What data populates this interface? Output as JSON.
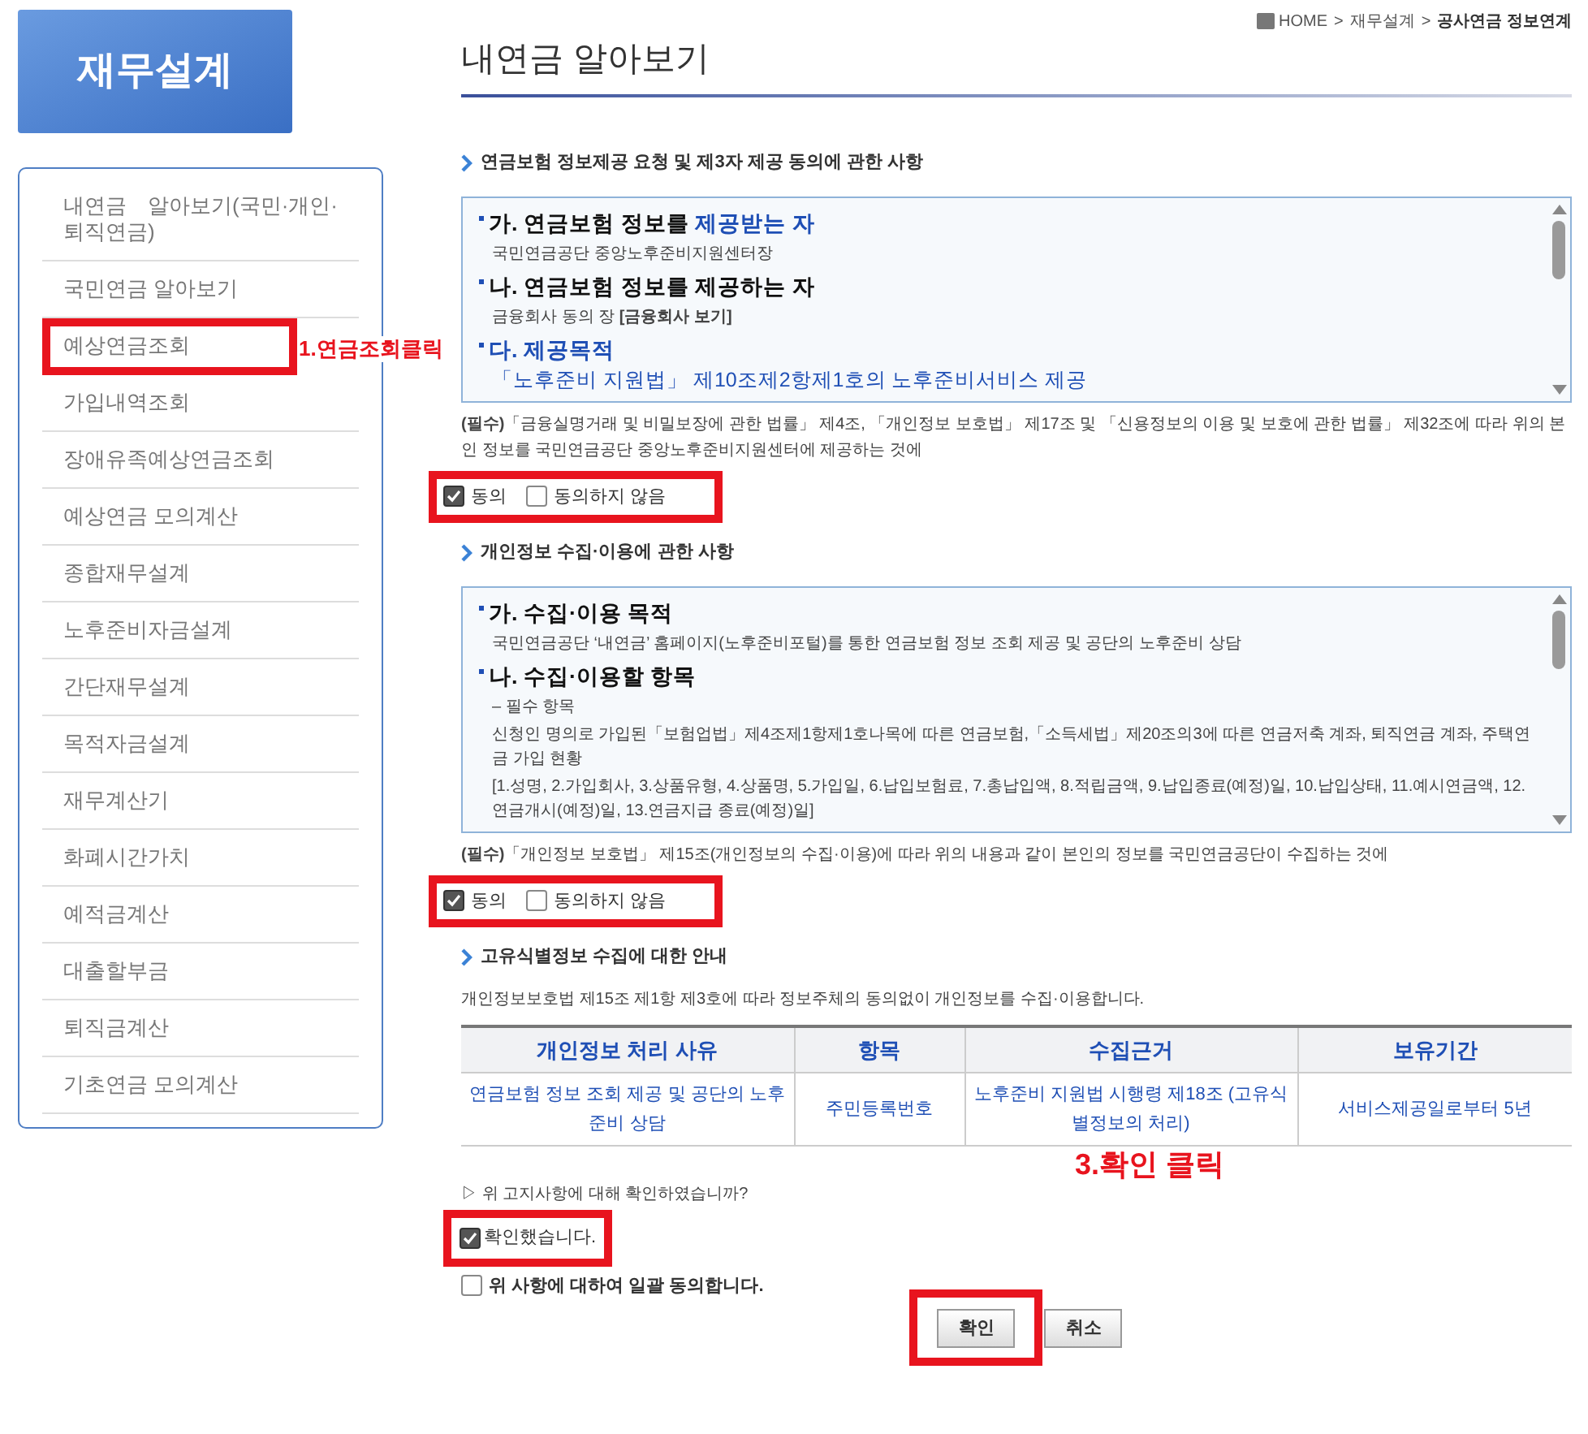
{
  "logo": "재무설계",
  "breadcrumb": [
    {
      "kind": "home",
      "label": "HOME"
    },
    {
      "kind": "sep",
      "label": ">"
    },
    {
      "kind": "link",
      "label": "재무설계"
    },
    {
      "kind": "sep",
      "label": ">"
    },
    {
      "kind": "current",
      "label": "공사연금 정보연계"
    }
  ],
  "sidebar": [
    {
      "label": "내연금　알아보기(국민·개인·퇴직연금)",
      "highlighted": false
    },
    {
      "label": "국민연금 알아보기",
      "highlighted": false
    },
    {
      "label": "예상연금조회",
      "highlighted": true
    },
    {
      "label": "가입내역조회",
      "highlighted": false
    },
    {
      "label": "장애유족예상연금조회",
      "highlighted": false
    },
    {
      "label": "예상연금 모의계산",
      "highlighted": false
    },
    {
      "label": "종합재무설계",
      "highlighted": false
    },
    {
      "label": "노후준비자금설계",
      "highlighted": false
    },
    {
      "label": "간단재무설계",
      "highlighted": false
    },
    {
      "label": "목적자금설계",
      "highlighted": false
    },
    {
      "label": "재무계산기",
      "highlighted": false
    },
    {
      "label": "화폐시간가치",
      "highlighted": false
    },
    {
      "label": "예적금계산",
      "highlighted": false
    },
    {
      "label": "대출할부금",
      "highlighted": false
    },
    {
      "label": "퇴직금계산",
      "highlighted": false
    },
    {
      "label": "기초연금 모의계산",
      "highlighted": false
    }
  ],
  "page_title": "내연금 알아보기",
  "sections": [
    {
      "heading": "연금보험 정보제공 요청 및 제3자 제공 동의에 관한 사항",
      "box": [
        {
          "kind": "heading",
          "parts": [
            {
              "text": "가. 연금보험 정보를 ",
              "blue": false
            },
            {
              "text": "제공받는 자",
              "blue": true
            }
          ]
        },
        {
          "kind": "text",
          "parts": [
            {
              "text": "국민연금공단 중앙노후준비지원센터장",
              "blue": false
            }
          ]
        },
        {
          "kind": "heading",
          "parts": [
            {
              "text": "나. 연금보험 정보를 제공하는 자",
              "blue": false
            }
          ]
        },
        {
          "kind": "text",
          "parts": [
            {
              "text": "금융회사 동의 장 **[금융회사 보기]**",
              "blue": false
            }
          ]
        },
        {
          "kind": "heading",
          "parts": [
            {
              "text": "다. 제공목적",
              "blue": true
            }
          ]
        },
        {
          "kind": "text",
          "parts": [
            {
              "text": "「노후준비 지원법」 제10조제2항제1호의 노후준비서비스 제공",
              "blue": true
            }
          ]
        }
      ],
      "notice": "**(필수)**「금융실명거래 및 비밀보장에 관한 법률」 제4조, 「개인정보 보호법」 제17조 및 「신용정보의 이용 및 보호에 관한 법률」 제32조에 따라 위의 본인 정보를 국민연금공단 중앙노후준비지원센터에 제공하는 것에",
      "options": [
        {
          "label": "동의",
          "checked": true
        },
        {
          "label": "동의하지 않음",
          "checked": false
        }
      ],
      "highlighted": true
    },
    {
      "heading": "개인정보 수집·이용에 관한 사항",
      "box": [
        {
          "kind": "heading",
          "parts": [
            {
              "text": "가. 수집·이용 목적",
              "blue": false
            }
          ]
        },
        {
          "kind": "text",
          "parts": [
            {
              "text": "국민연금공단 ‘내연금’ 홈페이지(노후준비포털)를 통한 연금보험 정보 조회 제공 및 공단의 노후준비 상담",
              "blue": false
            }
          ]
        },
        {
          "kind": "heading",
          "parts": [
            {
              "text": "나. 수집·이용할 항목",
              "blue": false
            }
          ]
        },
        {
          "kind": "text",
          "parts": [
            {
              "text": "– 필수 항목",
              "blue": false
            }
          ]
        },
        {
          "kind": "text",
          "parts": [
            {
              "text": "신청인 명의로 가입된「보험업법」제4조제1항제1호나목에 따른 연금보험,「소득세법」제20조의3에 따른 연금저축 계좌, 퇴직연금 계좌, 주택연금 가입 현황",
              "blue": false
            }
          ]
        },
        {
          "kind": "text",
          "parts": [
            {
              "text": "[1.성명, 2.가입회사, 3.상품유형, 4.상품명, 5.가입일, 6.납입보험료, 7.총납입액, 8.적립금액, 9.납입종료(예정)일, 10.납입상태, 11.예시연금액, 12.연금개시(예정)일, 13.연금지급 종료(예정)일]",
              "blue": false
            }
          ]
        }
      ],
      "notice": "**(필수)**「개인정보 보호법」 제15조(개인정보의 수집·이용)에 따라 위의 내용과 같이 본인의 정보를 국민연금공단이 수집하는 것에",
      "options": [
        {
          "label": "동의",
          "checked": true
        },
        {
          "label": "동의하지 않음",
          "checked": false
        }
      ],
      "highlighted": true
    }
  ],
  "unique_id": {
    "heading": "고유식별정보 수집에 대한 안내",
    "description": "개인정보보호법 제15조 제1항 제3호에 따라 정보주체의 동의없이 개인정보를 수집·이용합니다.",
    "table": {
      "columns": [
        "개인정보 처리 사유",
        "항목",
        "수집근거",
        "보유기간"
      ],
      "rows": [
        [
          "연금보험 정보 조회 제공 및 공단의 노후준비 상담",
          "주민등록번호",
          "노후준비 지원법 시행령 제18조 (고유식별정보의 처리)",
          "서비스제공일로부터 5년"
        ]
      ]
    },
    "question": "▷ 위 고지사항에 대해 확인하였습니까?",
    "confirm": {
      "label": "확인했습니다.",
      "checked": true,
      "highlighted": true
    },
    "all_agree": {
      "label": "위 사항에 대하여 일괄 동의합니다.",
      "checked": false
    },
    "buttons": [
      {
        "label": "확인",
        "highlighted": true
      },
      {
        "label": "취소",
        "highlighted": false
      }
    ]
  },
  "annotations": [
    {
      "text": "1.연금조회클릭"
    },
    {
      "text": "3.확인 클릭"
    }
  ]
}
